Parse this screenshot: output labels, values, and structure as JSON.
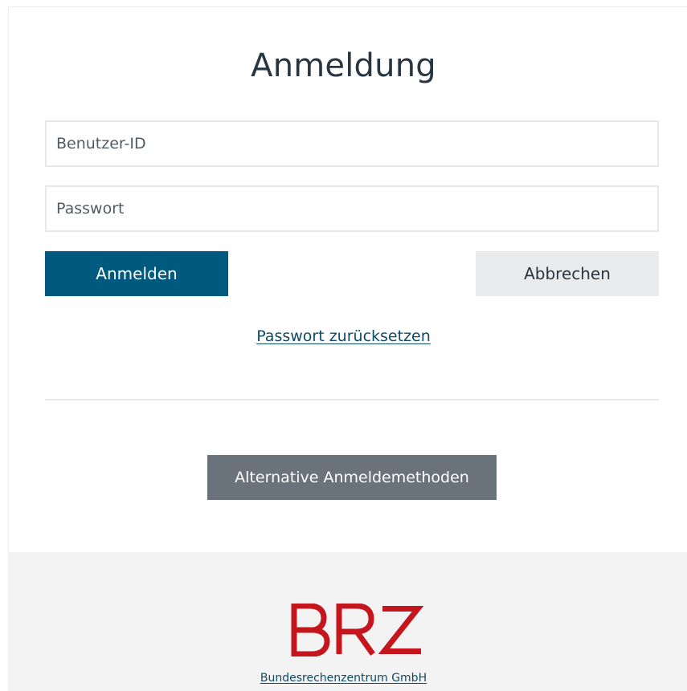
{
  "login": {
    "title": "Anmeldung",
    "user_placeholder": "Benutzer-ID",
    "user_value": "",
    "password_placeholder": "Passwort",
    "password_value": "",
    "submit_label": "Anmelden",
    "cancel_label": "Abbrechen",
    "reset_link": "Passwort zurücksetzen",
    "alt_methods_label": "Alternative Anmeldemethoden"
  },
  "footer": {
    "logo_text": "BRZ",
    "company_link": "Bundesrechenzentrum GmbH"
  },
  "colors": {
    "primary": "#005a7f",
    "secondary": "#e9ebed",
    "alt_button": "#6a737b",
    "brand_red": "#c4161c",
    "footer_bg": "#f3f3f4"
  }
}
